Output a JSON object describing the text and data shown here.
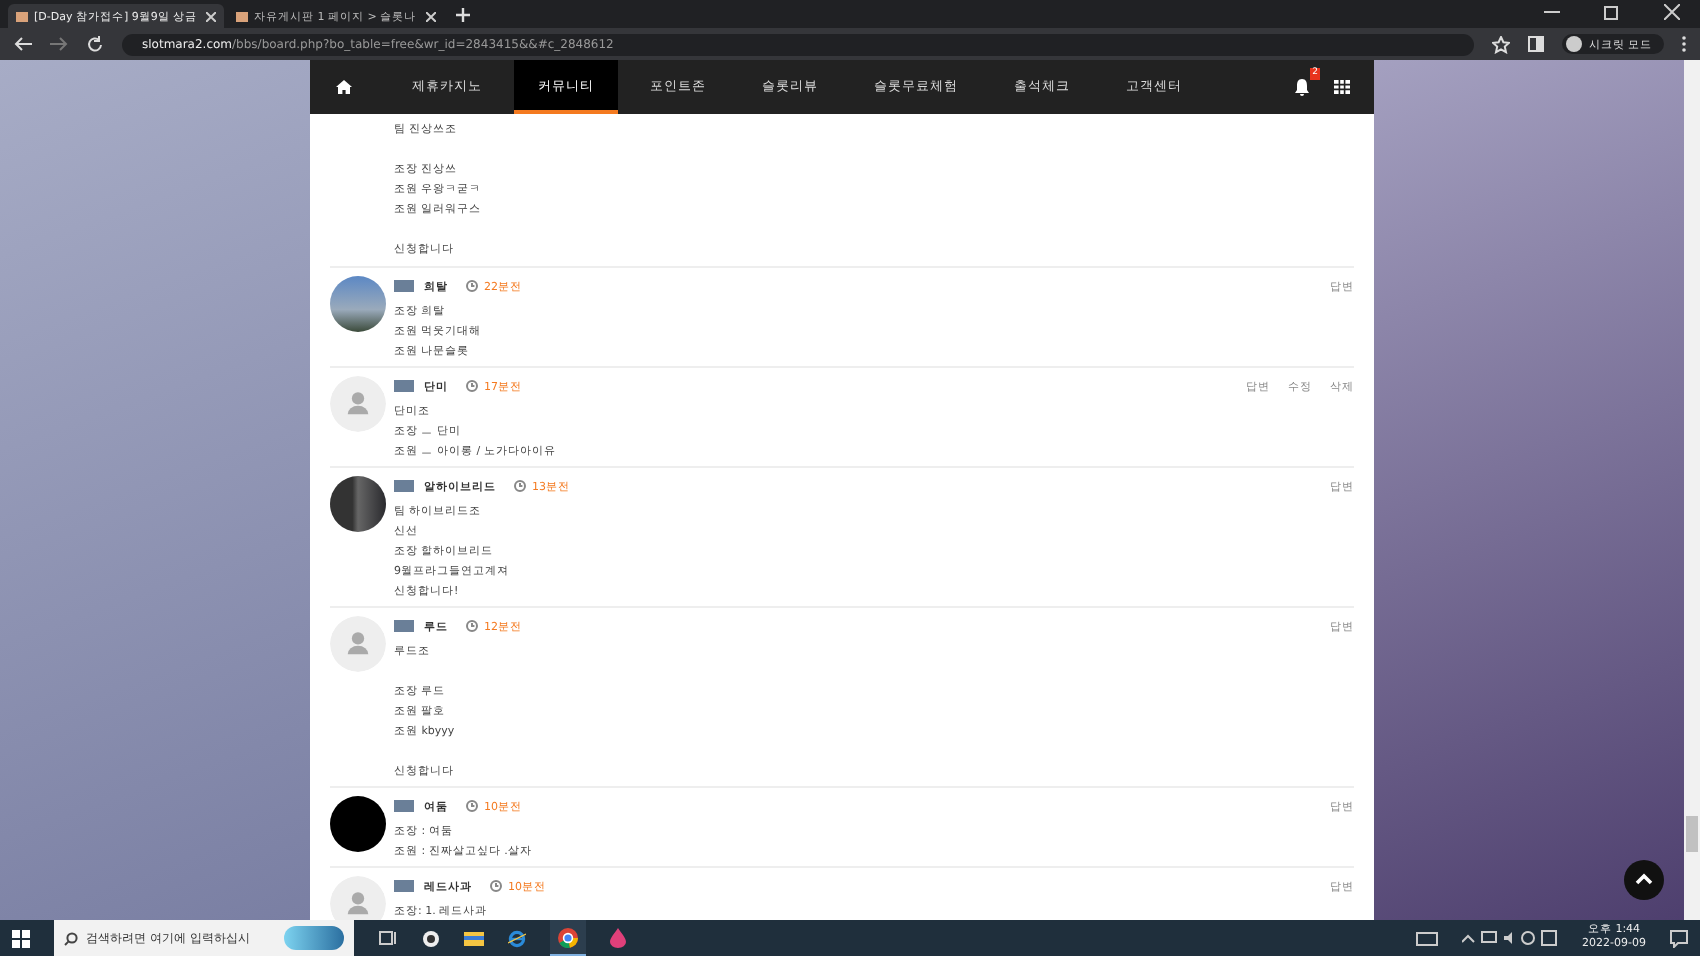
{
  "browser": {
    "tabs": [
      {
        "title": "[D-Day 참가접수] 9월9일 상금",
        "selected": true
      },
      {
        "title": "자유게시판 1 페이지 > 슬롯나",
        "selected": false
      }
    ],
    "url_host": "slotmara2.com",
    "url_path": "/bbs/board.php?bo_table=free&wr_id=2843415&&#c_2848612",
    "profile": "시크릿 모드"
  },
  "nav": {
    "items": [
      {
        "label": "제휴카지노",
        "selected": false
      },
      {
        "label": "커뮤니티",
        "selected": true
      },
      {
        "label": "포인트존",
        "selected": false
      },
      {
        "label": "슬롯리뷰",
        "selected": false
      },
      {
        "label": "슬롯무료체험",
        "selected": false
      },
      {
        "label": "출석체크",
        "selected": false
      },
      {
        "label": "고객센터",
        "selected": false
      }
    ],
    "notification_count": "2"
  },
  "partial_comment": {
    "paragraphs": [
      [
        "팀 진상쓰조"
      ],
      [
        "조장  진상쓰",
        "조원  우왕ㅋ굳ㅋ",
        "조원  일러워구스"
      ],
      [
        "신청합니다"
      ]
    ]
  },
  "comments": [
    {
      "name": "희탈",
      "time": "22분전",
      "has_photo": true,
      "actions": [
        "답변"
      ],
      "paragraphs": [
        [
          "조장 희탈",
          "조원 먹웃기대해",
          "조원 나문슬롯"
        ]
      ]
    },
    {
      "name": "단미",
      "time": "17분전",
      "has_photo": false,
      "actions": [
        "답변",
        "수정",
        "삭제"
      ],
      "paragraphs": [
        [
          "단미조",
          "조장 ㅡ 단미",
          "조원 ㅡ 아이롱 / 노가다아이유"
        ]
      ]
    },
    {
      "name": "알하이브리드",
      "time": "13분전",
      "has_photo": true,
      "actions": [
        "답변"
      ],
      "paragraphs": [
        [
          "팀 하이브리드조",
          "신선",
          "조장 할하이브리드",
          "9월프라그들연고계져",
          "신청합니다!"
        ]
      ]
    },
    {
      "name": "루드",
      "time": "12분전",
      "has_photo": false,
      "actions": [
        "답변"
      ],
      "paragraphs": [
        [
          "루드조"
        ],
        [
          "조장 루드",
          "조원 팔호",
          "조원 kbyyy"
        ],
        [
          "신청합니다"
        ]
      ]
    },
    {
      "name": "여둠",
      "time": "10분전",
      "has_photo": true,
      "actions": [
        "답변"
      ],
      "paragraphs": [
        [
          "조장 : 여둠",
          "조원 : 진짜살고싶다 .살자"
        ]
      ]
    },
    {
      "name": "레드사과",
      "time": "10분전",
      "has_photo": false,
      "actions": [
        "답변"
      ],
      "paragraphs": [
        [
          "조장: 1. 레드사과"
        ]
      ]
    }
  ],
  "taskbar": {
    "search_placeholder": "검색하려면 여기에 입력하십시",
    "time": "오후 1:44",
    "date": "2022-09-09"
  }
}
